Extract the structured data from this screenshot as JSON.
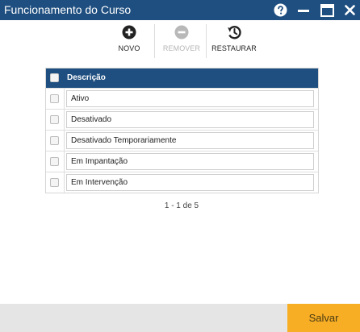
{
  "window": {
    "title": "Funcionamento do Curso",
    "colors": {
      "titlebar": "#1f4f80",
      "accent": "#f7ae25",
      "footer": "#e5e5e5"
    },
    "controls": [
      "help-icon",
      "minimize-icon",
      "maximize-icon",
      "close-icon"
    ]
  },
  "toolbar": {
    "novo": {
      "label": "NOVO",
      "icon": "plus-circle-icon",
      "enabled": true
    },
    "remover": {
      "label": "REMOVER",
      "icon": "minus-circle-icon",
      "enabled": false
    },
    "restaurar": {
      "label": "RESTAURAR",
      "icon": "history-icon",
      "enabled": true
    }
  },
  "grid": {
    "header": {
      "column": "Descrição"
    },
    "rows": [
      {
        "descricao": "Ativo"
      },
      {
        "descricao": "Desativado"
      },
      {
        "descricao": "Desativado Temporariamente"
      },
      {
        "descricao": "Em Impantação"
      },
      {
        "descricao": "Em Intervenção"
      }
    ]
  },
  "pager": {
    "text": "1 - 1 de 5"
  },
  "footer": {
    "save_label": "Salvar"
  }
}
